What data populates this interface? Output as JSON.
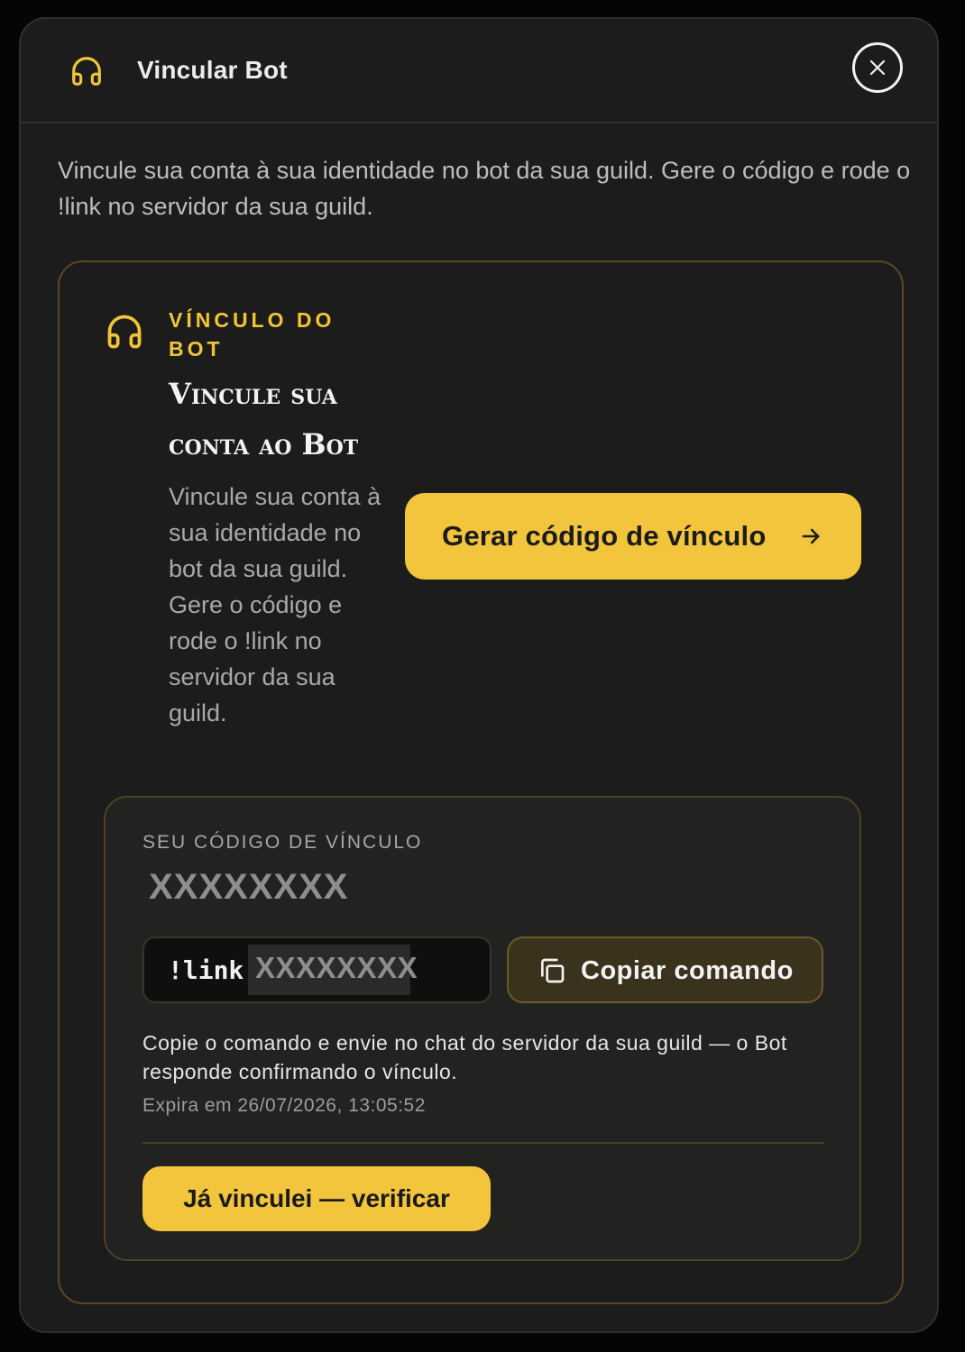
{
  "header": {
    "icon": "headphones-icon",
    "title": "Vincular Bot",
    "close_icon": "close-icon"
  },
  "intro": "Vincule sua conta à sua identidade no bot da sua guild. Gere o código e rode o !link no servidor da sua guild.",
  "card": {
    "icon": "headphones-icon",
    "eyebrow": "VÍNCULO DO BOT",
    "title": "Vincule sua conta ao Bot",
    "description": "Vincule sua conta à sua identidade no bot da sua guild. Gere o código e rode o !link no servidor da sua guild.",
    "generate_button": "Gerar código de vínculo",
    "generate_icon": "arrow-right-icon"
  },
  "code_panel": {
    "label": "SEU CÓDIGO DE VÍNCULO",
    "code": "XXXXXXXX",
    "command_prefix": "!link",
    "command_code": "XXXXXXXX",
    "copy_icon": "copy-icon",
    "copy_button": "Copiar comando",
    "instructions": "Copie o comando e envie no chat do servidor da sua guild — o Bot responde confirmando o vínculo.",
    "expiry": "Expira em 26/07/2026, 13:05:52",
    "verify_button": "Já vinculei — verificar"
  },
  "colors": {
    "accent": "#f2c53d",
    "background": "#1c1c1c",
    "page": "#050505",
    "panel": "#222220",
    "border_gold": "#5a4a22"
  }
}
